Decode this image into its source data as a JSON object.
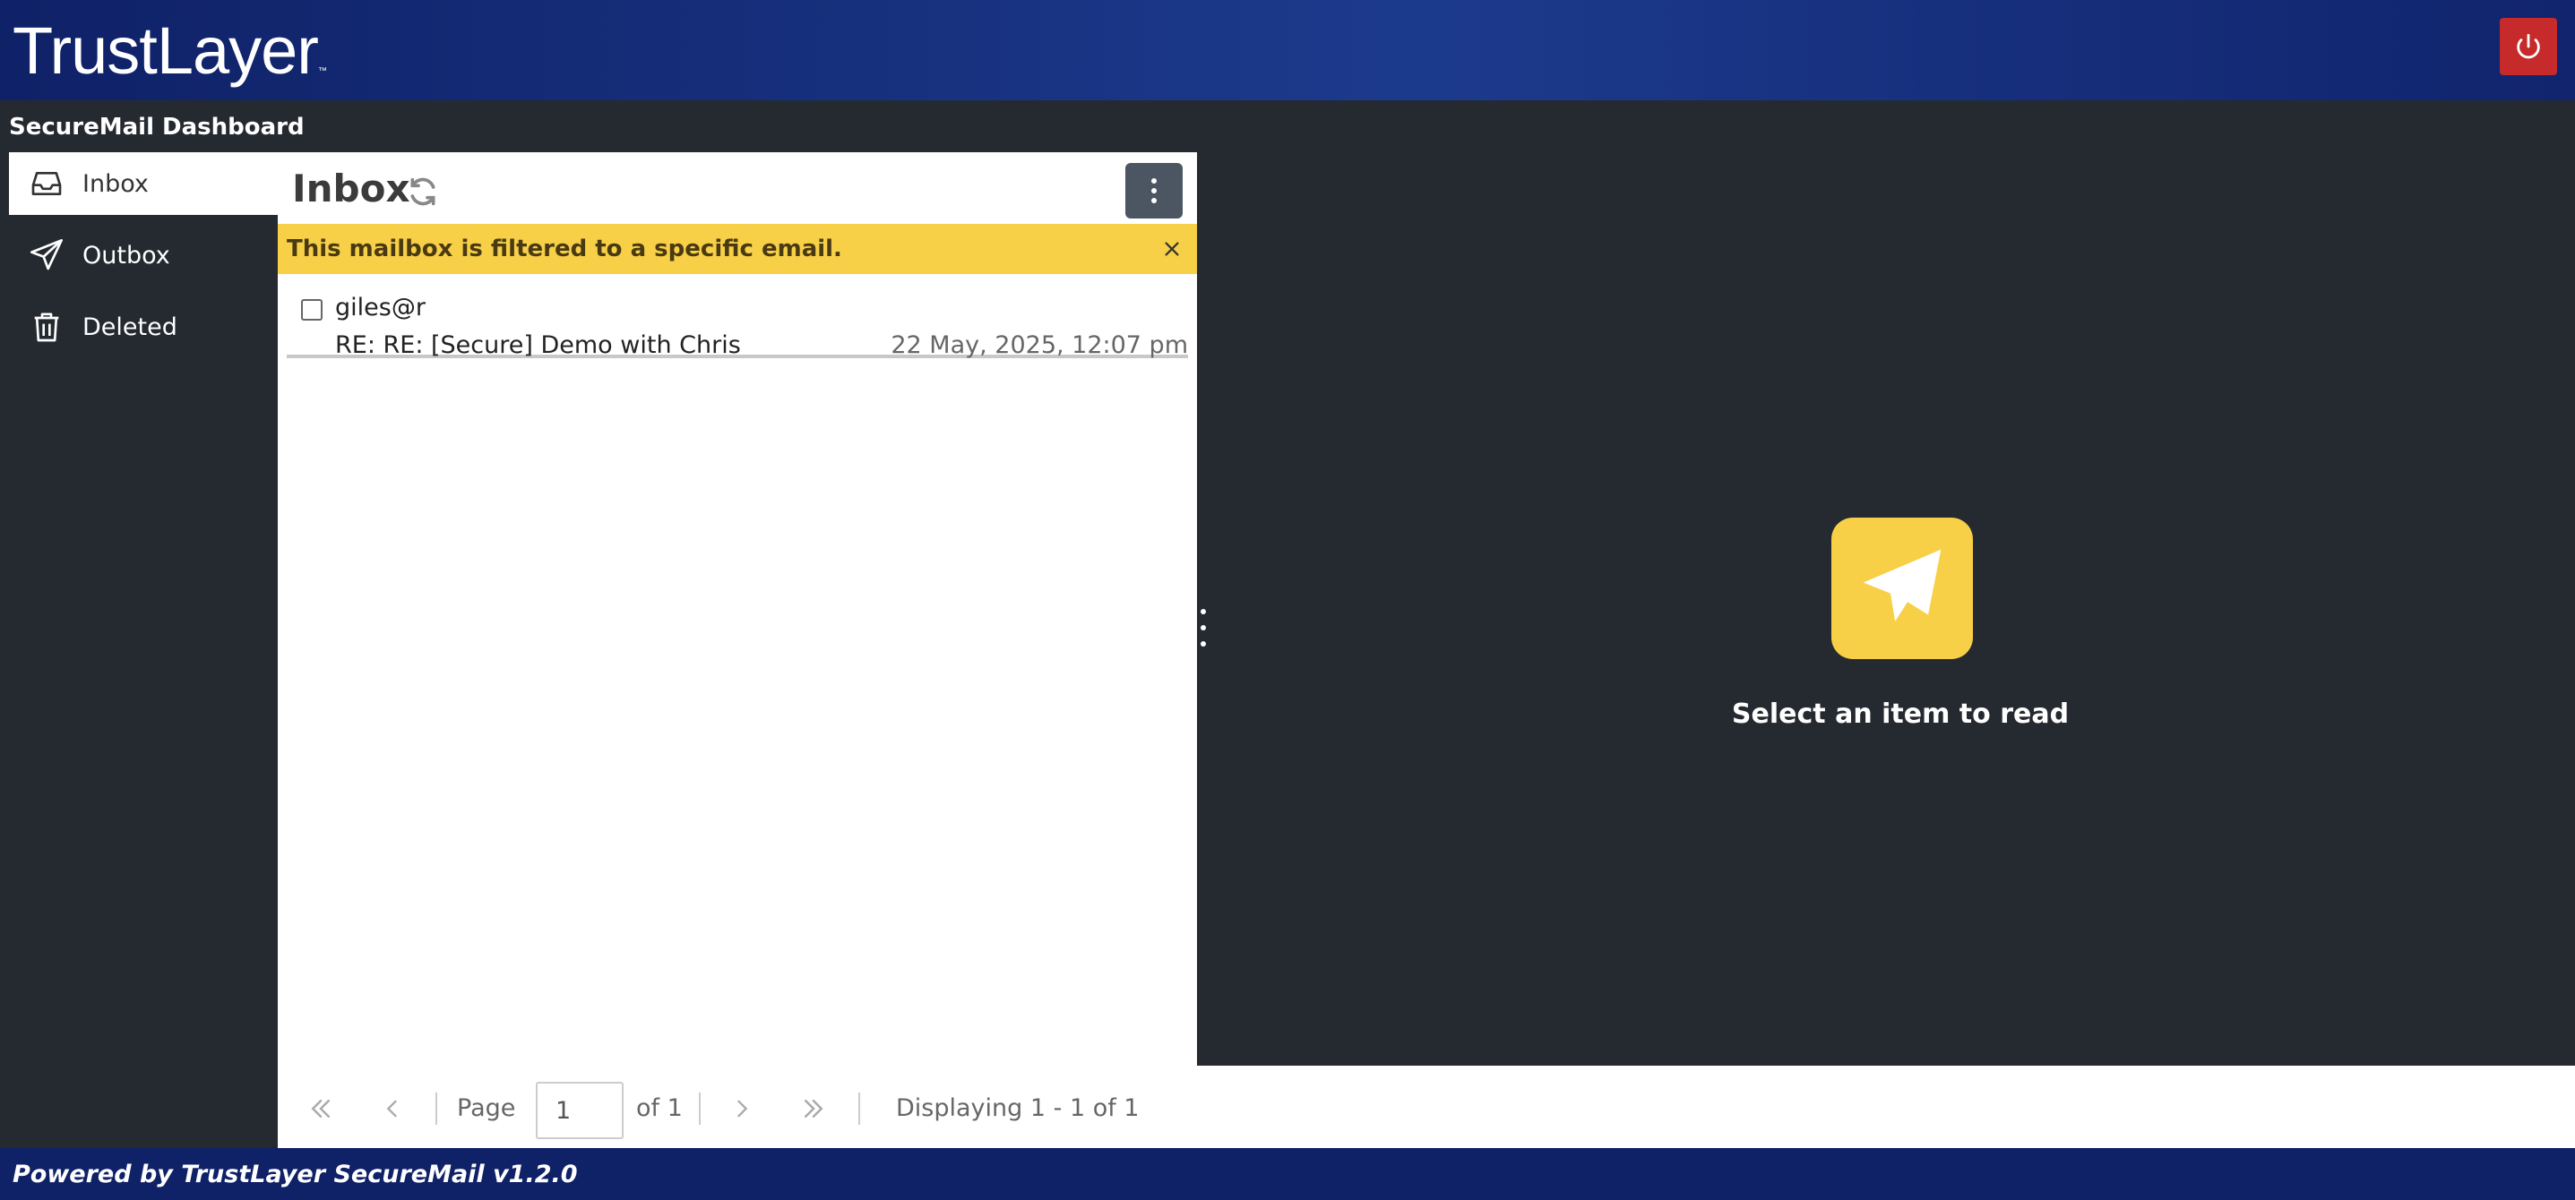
{
  "header": {
    "logo_text": "TrustLayer",
    "logo_tm": "™",
    "power_icon": "power-icon",
    "brand_color": "#0f2167",
    "power_color": "#c62a2a"
  },
  "dashboard": {
    "title": "SecureMail Dashboard"
  },
  "sidebar": {
    "items": [
      {
        "label": "Inbox",
        "icon": "inbox-icon",
        "active": true
      },
      {
        "label": "Outbox",
        "icon": "send-icon",
        "active": false
      },
      {
        "label": "Deleted",
        "icon": "trash-icon",
        "active": false
      }
    ]
  },
  "list": {
    "title": "Inbox",
    "refresh_icon": "refresh-icon",
    "menu_icon": "kebab-menu-icon",
    "banner": {
      "text": "This mailbox is filtered to a specific email.",
      "color": "#f7d047"
    },
    "messages": [
      {
        "from": "giles@r",
        "subject": "RE: RE: [Secure] Demo with Chris",
        "date": "22 May, 2025, 12:07 pm",
        "checked": false
      }
    ]
  },
  "pager": {
    "page_label": "Page",
    "page_value": "1",
    "of_label": "of 1",
    "display_text": "Displaying 1 - 1 of 1"
  },
  "reader": {
    "empty_text": "Select an item to read",
    "icon": "paper-plane-icon",
    "accent": "#f7d047"
  },
  "footer": {
    "text": "Powered by TrustLayer SecureMail v1.2.0"
  }
}
